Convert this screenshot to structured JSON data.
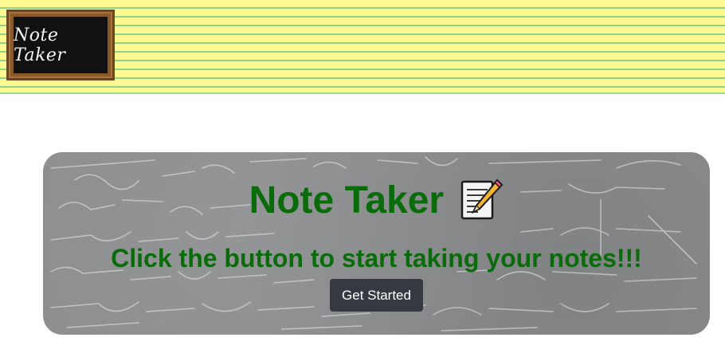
{
  "header": {
    "logo_text": "Note Taker",
    "colors": {
      "paper": "#fdf88f",
      "lines": "#8fd28a",
      "frame": "#8a5a2b",
      "board": "#111111"
    }
  },
  "hero": {
    "title": "Note Taker",
    "title_icon": "memo-icon",
    "subtitle": "Click the button to start taking your notes!!!",
    "button_label": "Get Started",
    "colors": {
      "text": "#0a6b0a",
      "button": "#343a40",
      "background": "#8b8d8f"
    }
  }
}
